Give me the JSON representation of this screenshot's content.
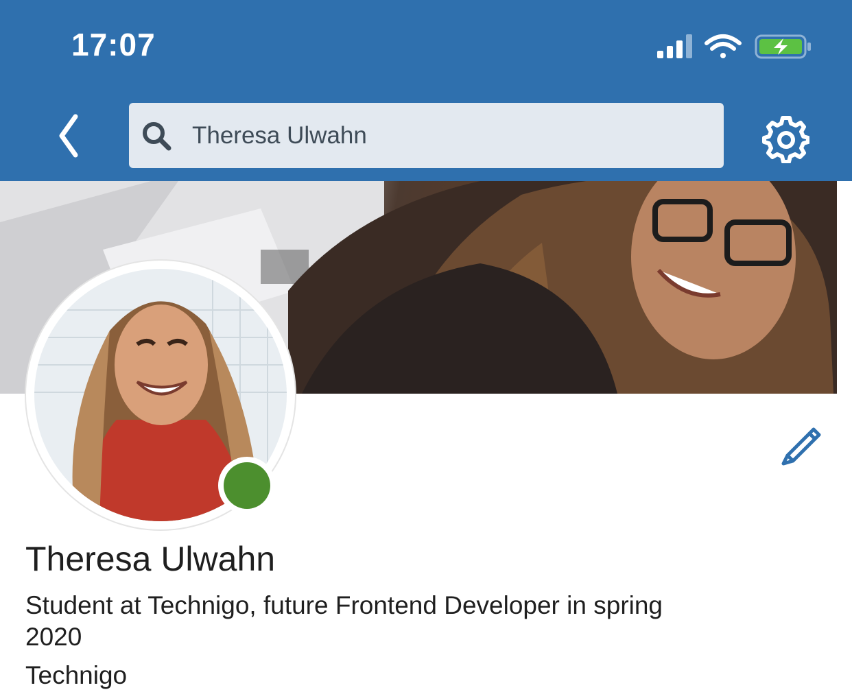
{
  "status_bar": {
    "time": "17:07",
    "icons": [
      "signal-icon",
      "wifi-icon",
      "battery-charging-icon"
    ]
  },
  "nav": {
    "back_icon": "chevron-left-icon",
    "search": {
      "value": "Theresa Ulwahn",
      "icon": "search-icon"
    },
    "settings_icon": "gear-icon"
  },
  "profile": {
    "name": "Theresa Ulwahn",
    "headline": "Student at Technigo, future Frontend Developer in spring 2020",
    "company": "Technigo",
    "presence": "online",
    "edit_icon": "pencil-icon"
  },
  "colors": {
    "brand": "#2f70ae",
    "search_bg": "#e3e9f0",
    "presence_green": "#4c8f2e",
    "text": "#1f1f1f"
  }
}
